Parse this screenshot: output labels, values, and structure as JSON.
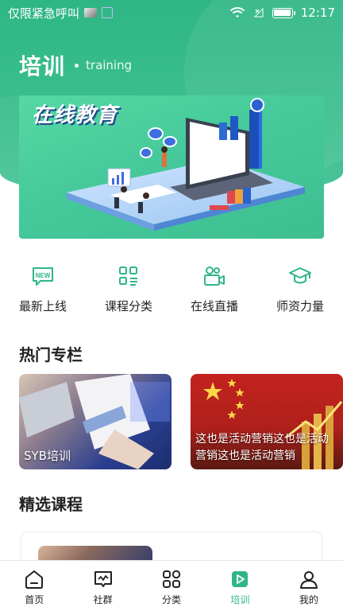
{
  "status_bar": {
    "carrier": "仅限紧急呼叫",
    "time": "12:17"
  },
  "header": {
    "title": "培训",
    "subtitle": "training"
  },
  "banner": {
    "headline": "在线教育"
  },
  "quick_entries": [
    {
      "label": "最新上线",
      "icon": "new-badge-icon",
      "badge": "NEW"
    },
    {
      "label": "课程分类",
      "icon": "category-list-icon"
    },
    {
      "label": "在线直播",
      "icon": "live-camera-icon"
    },
    {
      "label": "师资力量",
      "icon": "graduation-cap-icon"
    }
  ],
  "hot_columns": {
    "title": "热门专栏",
    "items": [
      {
        "caption": "SYB培训"
      },
      {
        "caption": "这也是活动营销这也是活动营销这也是活动营销"
      }
    ]
  },
  "featured": {
    "title": "精选课程"
  },
  "tabbar": {
    "items": [
      {
        "label": "首页",
        "icon": "home-icon"
      },
      {
        "label": "社群",
        "icon": "community-icon"
      },
      {
        "label": "分类",
        "icon": "grid-icon"
      },
      {
        "label": "培训",
        "icon": "play-icon",
        "active": true
      },
      {
        "label": "我的",
        "icon": "user-icon"
      }
    ]
  },
  "colors": {
    "brand": "#2fb686",
    "text": "#222222"
  }
}
